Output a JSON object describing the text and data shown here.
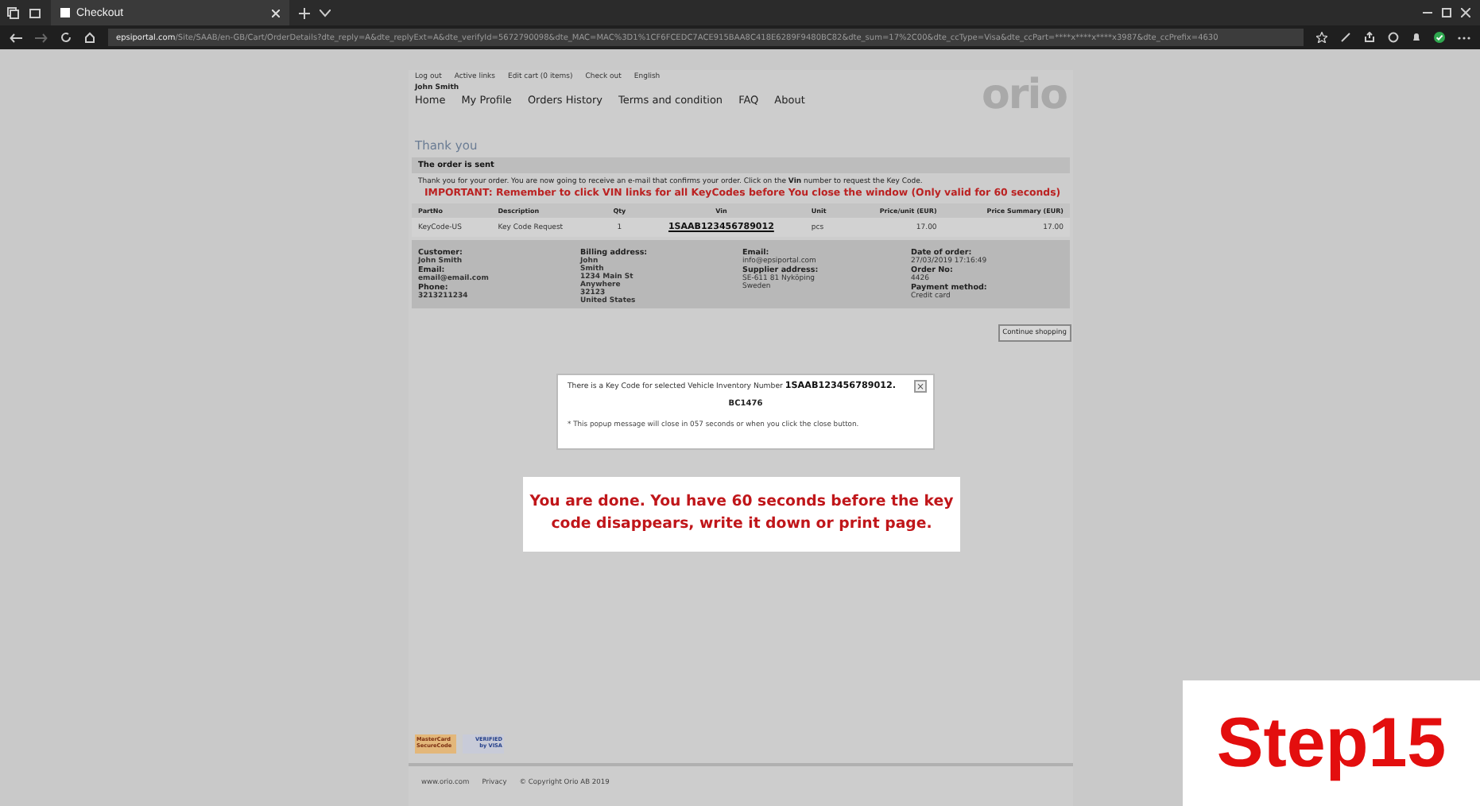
{
  "browser": {
    "tab_title": "Checkout",
    "url_host": "epsiportal.com",
    "url_path": "/Site/SAAB/en-GB/Cart/OrderDetails?dte_reply=A&dte_replyExt=A&dte_verifyId=5672790098&dte_MAC=MAC%3D1%1CF6FCEDC7ACE915BAA8C418E6289F9480BC82&dte_sum=17%2C00&dte_ccType=Visa&dte_ccPart=****x****x****x3987&dte_ccPrefix=4630"
  },
  "top_links": [
    "Log out",
    "Active links",
    "Edit cart (0 items)",
    "Check out",
    "English"
  ],
  "user_name": "John Smith",
  "nav": [
    {
      "label": "Home"
    },
    {
      "label": "My Profile"
    },
    {
      "label": "Orders History"
    },
    {
      "label": "Terms and condition"
    },
    {
      "label": "FAQ"
    },
    {
      "label": "About"
    }
  ],
  "logo": "orio",
  "page_title": "Thank you",
  "section_title": "The order is sent",
  "intro": "Thank you for your order. You are now going to receive an e-mail that confirms your order. Click on the **Vin** number to request the Key Code.",
  "important": "IMPORTANT: Remember to click VIN links for all KeyCodes before You close the window (Only valid for 60 seconds)",
  "table": {
    "columns": [
      "PartNo",
      "Description",
      "Qty",
      "Vin",
      "Unit",
      "Price/unit (EUR)",
      "Price Summary (EUR)"
    ],
    "rows": [
      [
        "KeyCode-US",
        "Key Code Request",
        "1",
        "1SAAB123456789012",
        "pcs",
        "17.00",
        "17.00"
      ]
    ]
  },
  "details": [
    [
      {
        "label": "Customer:",
        "values": [
          "John Smith"
        ]
      },
      {
        "label": "Email:",
        "values": [
          "email@email.com"
        ]
      },
      {
        "label": "Phone:",
        "values": [
          "3213211234"
        ]
      }
    ],
    [
      {
        "label": "Billing address:",
        "values": [
          "John",
          "Smith",
          "1234 Main St",
          "Anywhere",
          "32123",
          "United States"
        ]
      }
    ],
    [
      {
        "label": "Email:",
        "values": [
          "info@epsiportal.com"
        ]
      },
      {
        "label": "Supplier address:",
        "values": [
          "SE-611 81 Nyköping",
          "Sweden"
        ]
      }
    ],
    [
      {
        "label": "Date of order:",
        "values": [
          "27/03/2019 17:16:49"
        ]
      },
      {
        "label": "Order No:",
        "values": [
          "4426"
        ]
      },
      {
        "label": "Payment method:",
        "values": [
          "Credit card"
        ]
      }
    ]
  ],
  "continue_button": "Continue shopping",
  "popup": {
    "message": "There is a Key Code for selected Vehicle Inventory Number **1SAAB123456789012.**",
    "code": "BC1476",
    "note": "* This popup message will close in 057 seconds or when you click the close button.",
    "close": "×"
  },
  "callout": "You are done. You have 60 seconds before the key code disappears, write it down or print page.",
  "step_label": "Step15",
  "card_logos": [
    {
      "top": "MasterCard",
      "bottom": "SecureCode"
    },
    {
      "top": "VERIFIED",
      "bottom": "by VISA"
    }
  ],
  "footer": [
    "www.orio.com",
    "Privacy",
    "© Copyright Orio AB 2019"
  ]
}
